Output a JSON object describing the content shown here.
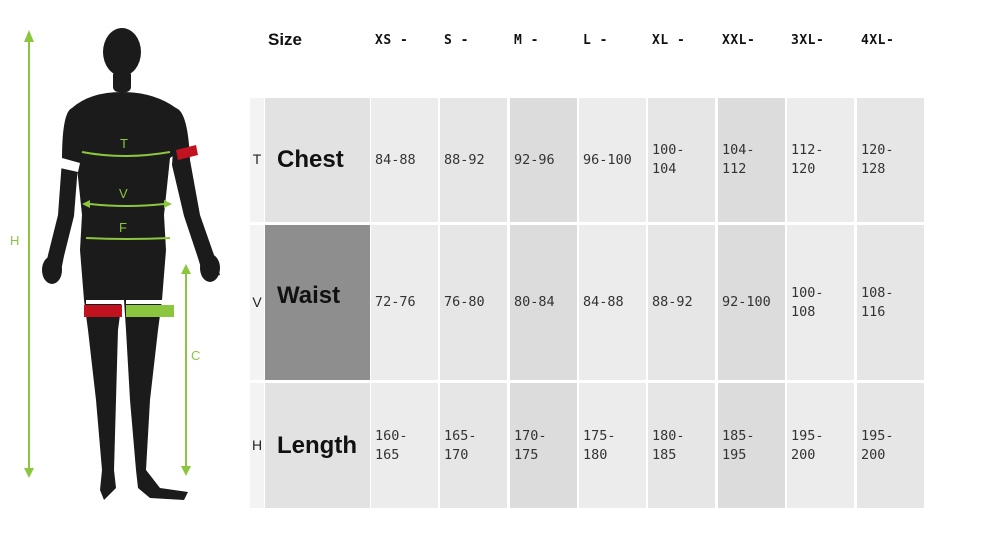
{
  "figure": {
    "labels": {
      "T": "T",
      "V": "V",
      "F": "F",
      "H": "H",
      "C": "C"
    },
    "colors": {
      "body": "#1a1a1a",
      "accent_green": "#8cc63f",
      "accent_red": "#c1121f",
      "arrow": "#8cc63f"
    }
  },
  "table": {
    "size_title": "Size",
    "sizes": [
      "XS -",
      "S -",
      "M -",
      "L -",
      "XL -",
      "XXL-",
      "3XL-",
      "4XL-"
    ],
    "rows": [
      {
        "letter": "T",
        "label": "Chest",
        "values": [
          "84-88",
          "88-92",
          "92-96",
          "96-100",
          "100-\n104",
          "104-\n112",
          "112-\n120",
          "120-\n128"
        ]
      },
      {
        "letter": "V",
        "label": "Waist",
        "values": [
          "72-76",
          "76-80",
          "80-84",
          "84-88",
          "88-92",
          "92-100",
          "100-\n108",
          "108-\n116"
        ]
      },
      {
        "letter": "H",
        "label": "Length",
        "values": [
          "160-\n165",
          "165-\n170",
          "170-\n175",
          "175-\n180",
          "180-\n185",
          "185-\n195",
          "195-\n200",
          "195-\n200"
        ]
      }
    ],
    "colors": {
      "letter_col": "#f3f3f3",
      "label_cell": "#e2e2e2",
      "label_cell_active": "#8e8e8e",
      "row_light": "#ececec",
      "row_mid": "#e6e6e6",
      "row_dark": "#dcdcdc",
      "gap": "#ffffff"
    }
  }
}
